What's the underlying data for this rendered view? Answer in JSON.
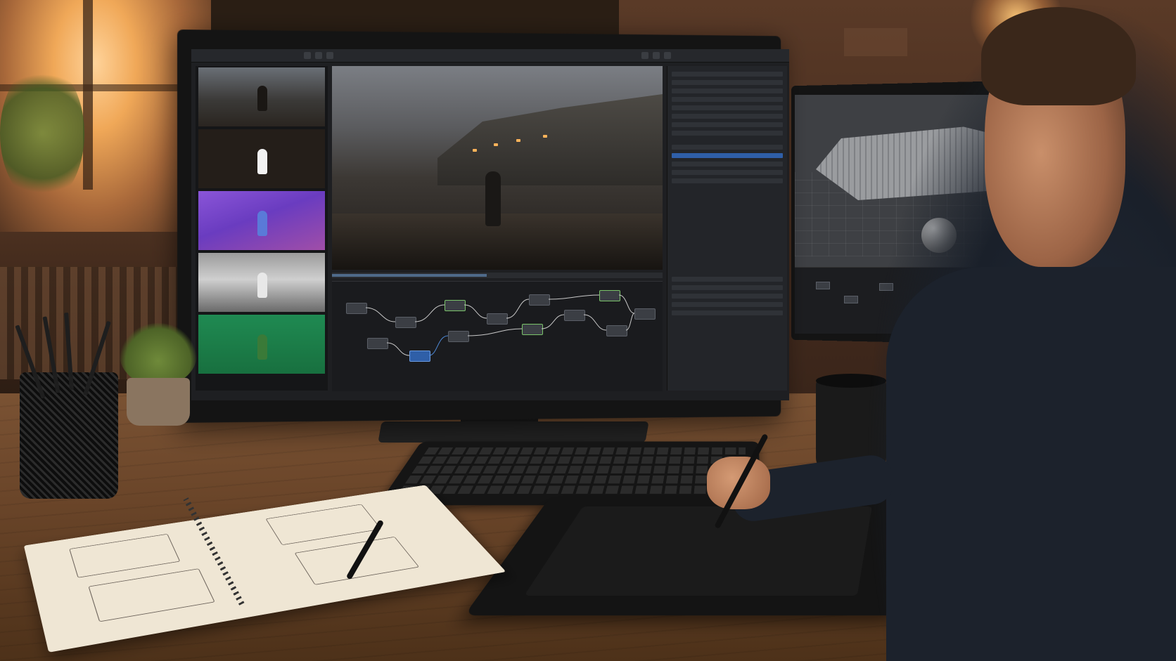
{
  "scene": {
    "main_app": {
      "panels": [
        "thumbnail-strip",
        "viewer",
        "node-graph",
        "properties-panel"
      ],
      "thumbnails": [
        "beauty",
        "matte",
        "normals",
        "depth",
        "green-pass"
      ]
    },
    "second_app": {
      "panels": [
        "3d-viewport",
        "node-graph"
      ]
    }
  }
}
